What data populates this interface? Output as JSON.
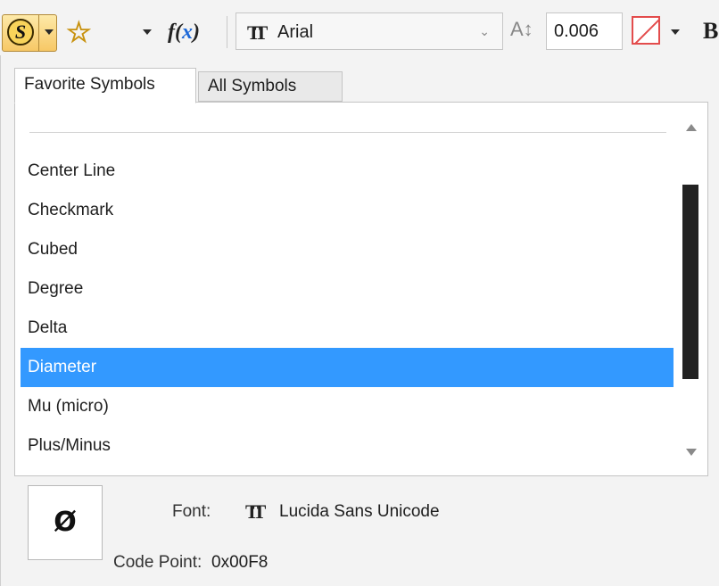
{
  "toolbar": {
    "symbol_glyph": "S",
    "fx_label_prefix": "f(",
    "fx_label_x": "x",
    "fx_label_suffix": ")",
    "font_icon": "T",
    "font_name": "Arial",
    "height_icon": "A↕",
    "text_height": "0.006",
    "bold_glyph": "B",
    "colors": {
      "star": "#f5c518",
      "symbol_button": "#f7c866",
      "no_fill": "#e34c4c"
    }
  },
  "tabs": [
    {
      "label": "Favorite Symbols",
      "active": true
    },
    {
      "label": "All Symbols",
      "active": false
    }
  ],
  "list": {
    "items": [
      "Center Line",
      "Checkmark",
      "Cubed",
      "Degree",
      "Delta",
      "Diameter",
      "Mu (micro)",
      "Plus/Minus"
    ],
    "selected": "Diameter",
    "selected_color": "#3399ff"
  },
  "details": {
    "preview_glyph": "Ø",
    "font_label": "Font:",
    "font_value": "Lucida Sans Unicode",
    "code_point_label": "Code Point:",
    "code_point_value": "0x00F8"
  }
}
